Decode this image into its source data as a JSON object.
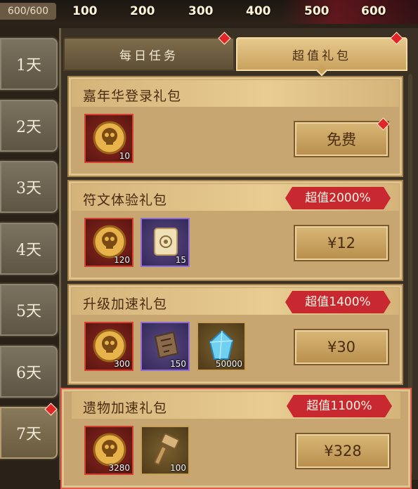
{
  "progress": {
    "label": "600/600",
    "milestones": [
      "100",
      "200",
      "300",
      "400",
      "500",
      "600"
    ]
  },
  "days": [
    "1天",
    "2天",
    "3天",
    "4天",
    "5天",
    "6天",
    "7天"
  ],
  "tabs": {
    "daily": "每日任务",
    "value_pack": "超值礼包"
  },
  "packages": [
    {
      "title": "嘉年华登录礼包",
      "badge": "",
      "price": "免费",
      "items": [
        {
          "icon": "skull-coin-icon",
          "frame": "red",
          "qty": "10"
        }
      ]
    },
    {
      "title": "符文体验礼包",
      "badge": "超值2000%",
      "price": "¥12",
      "items": [
        {
          "icon": "skull-coin-icon",
          "frame": "red",
          "qty": "120"
        },
        {
          "icon": "rune-scroll-icon",
          "frame": "purple",
          "qty": "15"
        }
      ]
    },
    {
      "title": "升级加速礼包",
      "badge": "超值1400%",
      "price": "¥30",
      "items": [
        {
          "icon": "skull-coin-icon",
          "frame": "red",
          "qty": "300"
        },
        {
          "icon": "blueprint-scroll-icon",
          "frame": "purple",
          "qty": "150"
        },
        {
          "icon": "blue-crystal-icon",
          "frame": "gold",
          "qty": "50000"
        }
      ]
    },
    {
      "title": "遗物加速礼包",
      "badge": "超值1100%",
      "price": "¥328",
      "items": [
        {
          "icon": "skull-coin-icon",
          "frame": "red",
          "qty": "3280"
        },
        {
          "icon": "hammer-icon",
          "frame": "gold",
          "qty": "100"
        }
      ]
    }
  ],
  "colors": {
    "badge": "#c8282f",
    "notification": "#e0262a",
    "card": "#c7a672"
  }
}
